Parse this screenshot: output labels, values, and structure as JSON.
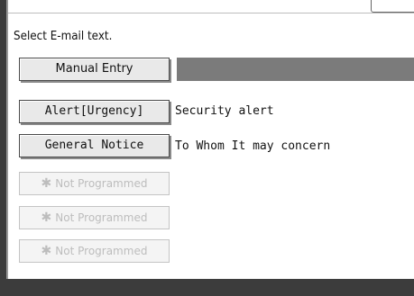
{
  "header": {
    "title_fragment": "",
    "tab_label": ""
  },
  "instruction": "Select E-mail text.",
  "entries": [
    {
      "button_label": "Manual Entry",
      "value": ""
    },
    {
      "button_label": "Alert[Urgency]",
      "value": "Security alert"
    },
    {
      "button_label": "General Notice",
      "value": "To Whom It may concern"
    }
  ],
  "not_programmed": {
    "label": "Not Programmed",
    "icon": "asterisk-icon",
    "count": 3
  },
  "colors": {
    "frame_dark": "#3c3c3c",
    "input_field": "#7b7b7b",
    "button_face": "#e9e9e9",
    "disabled_text": "#bdbdbd"
  }
}
